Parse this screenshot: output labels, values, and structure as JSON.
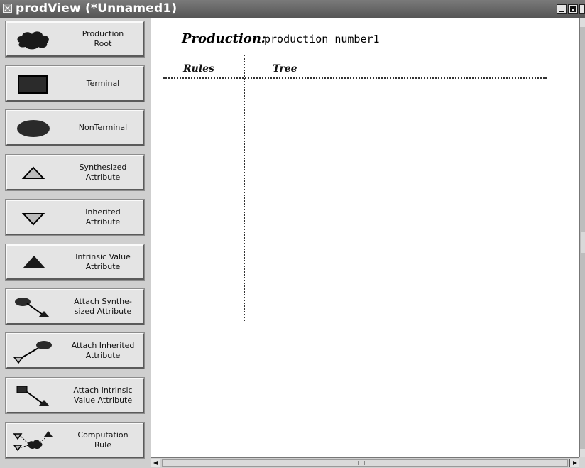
{
  "window": {
    "title": "prodView (*Unnamed1)"
  },
  "palette": {
    "tools": [
      {
        "label": "Production\nRoot",
        "icon": "cloud-icon"
      },
      {
        "label": "Terminal",
        "icon": "rectangle-icon"
      },
      {
        "label": "NonTerminal",
        "icon": "ellipse-icon"
      },
      {
        "label": "Synthesized\nAttribute",
        "icon": "triangle-up-outline-icon"
      },
      {
        "label": "Inherited\nAttribute",
        "icon": "triangle-down-outline-icon"
      },
      {
        "label": "Intrinsic Value\nAttribute",
        "icon": "triangle-up-filled-icon"
      },
      {
        "label": "Attach Synthe-\nsized Attribute",
        "icon": "attach-synthesized-icon"
      },
      {
        "label": "Attach Inherited\nAttribute",
        "icon": "attach-inherited-icon"
      },
      {
        "label": "Attach Intrinsic\nValue Attribute",
        "icon": "attach-intrinsic-icon"
      },
      {
        "label": "Computation\nRule",
        "icon": "computation-rule-icon"
      }
    ]
  },
  "canvas": {
    "production_label": "Production:",
    "production_name": "production number1",
    "rules_header": "Rules",
    "tree_header": "Tree"
  }
}
